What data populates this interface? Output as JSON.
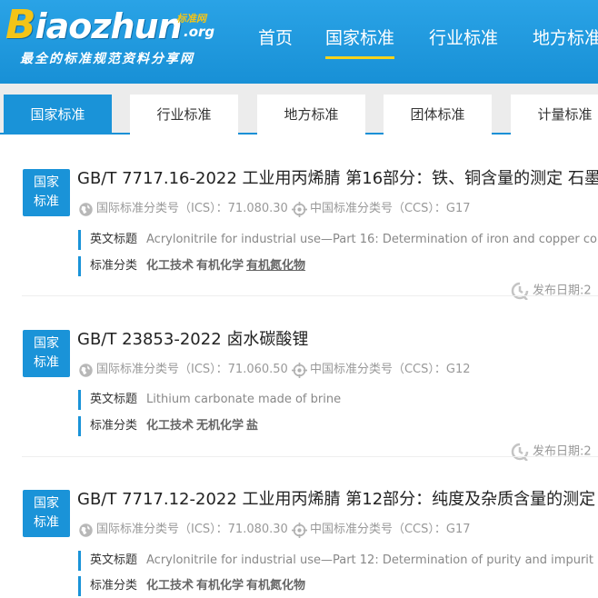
{
  "logo": {
    "word_cap": "B",
    "word_rest": "iaozhun",
    "org": ".org",
    "cn": "标准网",
    "slogan": "最全的标准规范资料分享网"
  },
  "topnav": [
    {
      "label": "首页"
    },
    {
      "label": "国家标准"
    },
    {
      "label": "行业标准"
    },
    {
      "label": "地方标准"
    }
  ],
  "tabs": [
    {
      "label": "国家标准"
    },
    {
      "label": "行业标准"
    },
    {
      "label": "地方标准"
    },
    {
      "label": "团体标准"
    },
    {
      "label": "计量标准"
    }
  ],
  "entries": [
    {
      "badge_line1": "国家",
      "badge_line2": "标准",
      "title": "GB/T 7717.16-2022 工业用丙烯腈 第16部分：铁、铜含量的测定 石墨",
      "ics_text": "国际标准分类号（ICS）：71.080.30",
      "ccs_text": "中国标准分类号（CCS）：G17",
      "en_label": "英文标题",
      "en_title": "Acrylonitrile for industrial use—Part 16: Determination of iron and copper co",
      "cat_label": "标准分类",
      "cats": [
        "化工技术",
        "有机化学",
        "有机氮化物"
      ],
      "pub": "发布日期:2"
    },
    {
      "badge_line1": "国家",
      "badge_line2": "标准",
      "title": "GB/T 23853-2022 卤水碳酸锂",
      "ics_text": "国际标准分类号（ICS）：71.060.50",
      "ccs_text": "中国标准分类号（CCS）：G12",
      "en_label": "英文标题",
      "en_title": "Lithium carbonate made of brine",
      "cat_label": "标准分类",
      "cats": [
        "化工技术",
        "无机化学",
        "盐"
      ],
      "pub": "发布日期:2"
    },
    {
      "badge_line1": "国家",
      "badge_line2": "标准",
      "title": "GB/T 7717.12-2022 工业用丙烯腈 第12部分：纯度及杂质含量的测定",
      "ics_text": "国际标准分类号（ICS）：71.080.30",
      "ccs_text": "中国标准分类号（CCS）：G17",
      "en_label": "英文标题",
      "en_title": "Acrylonitrile for industrial use—Part 12: Determination of purity and impurit",
      "cat_label": "标准分类",
      "cats": [
        "化工技术",
        "有机化学",
        "有机氮化物"
      ],
      "pub": "发布日期:2"
    }
  ],
  "colors": {
    "header_blue": "#1a93d8",
    "accent_yellow": "#f5d21c",
    "text_dark": "#222222",
    "text_gray": "#999999"
  }
}
